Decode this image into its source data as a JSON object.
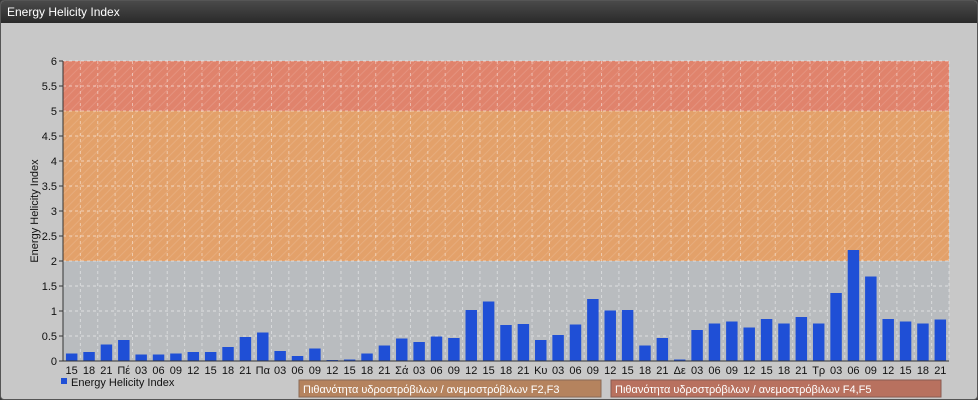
{
  "window": {
    "title": "Energy Helicity Index"
  },
  "chart_data": {
    "type": "bar",
    "ylabel": "Energy Helicity Index",
    "ylim": [
      0,
      6
    ],
    "yticks": [
      "0",
      "0.5",
      "1",
      "1.5",
      "2",
      "2.5",
      "3",
      "3.5",
      "4",
      "4.5",
      "5",
      "5.5",
      "6"
    ],
    "grid": true,
    "categories": [
      "15",
      "18",
      "21",
      "Πέ",
      "03",
      "06",
      "09",
      "12",
      "15",
      "18",
      "21",
      "Πα",
      "03",
      "06",
      "09",
      "12",
      "15",
      "18",
      "21",
      "Σά",
      "03",
      "06",
      "09",
      "12",
      "15",
      "18",
      "21",
      "Κυ",
      "03",
      "06",
      "09",
      "12",
      "15",
      "18",
      "21",
      "Δε",
      "03",
      "06",
      "09",
      "12",
      "15",
      "18",
      "21",
      "Τρ",
      "03",
      "06",
      "09",
      "12",
      "15",
      "18",
      "21"
    ],
    "values": [
      0.15,
      0.18,
      0.33,
      0.42,
      0.13,
      0.13,
      0.15,
      0.18,
      0.18,
      0.28,
      0.48,
      0.57,
      0.2,
      0.1,
      0.25,
      0.02,
      0.03,
      0.15,
      0.31,
      0.45,
      0.38,
      0.49,
      0.46,
      1.02,
      1.19,
      0.72,
      0.74,
      0.42,
      0.52,
      0.73,
      1.24,
      1.01,
      1.02,
      0.31,
      0.46,
      0.03,
      0.62,
      0.75,
      0.79,
      0.67,
      0.84,
      0.75,
      0.88,
      0.75,
      1.36,
      2.22,
      1.69,
      0.84,
      0.79,
      0.75,
      0.83
    ],
    "bar_color": "#1f4fd6",
    "bands": [
      {
        "from": 2,
        "to": 5,
        "color": "#e3a16a",
        "label": "Πιθανότητα υδροστρόβιλων / ανεμοστρόβιλων F2,F3"
      },
      {
        "from": 5,
        "to": 6,
        "color": "#e0836c",
        "label": "Πιθανότητα υδροστρόβιλων / ανεμοστρόβιλων F4,F5"
      }
    ],
    "series": [
      {
        "name": "Energy Helicity Index",
        "color": "#1f4fd6"
      }
    ],
    "legend": {
      "placement": "bottom-left",
      "series_label": "Energy Helicity Index",
      "band1_label": "Πιθανότητα υδροστρόβιλων / ανεμοστρόβιλων F2,F3",
      "band1_color": "#b5835e",
      "band2_label": "Πιθανότητα υδροστρόβιλων / ανεμοστρόβιλων F4,F5",
      "band2_color": "#b8715f"
    }
  }
}
